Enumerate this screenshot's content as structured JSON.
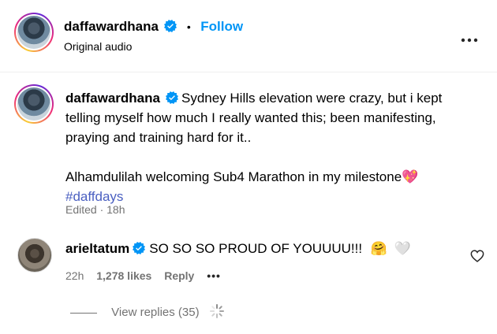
{
  "header": {
    "username": "daffawardhana",
    "separator": "•",
    "follow_label": "Follow",
    "subtitle": "Original audio",
    "more_icon": "more-horizontal-icon"
  },
  "caption": {
    "username": "daffawardhana",
    "text_line1": "Sydney Hills elevation were crazy, but i kept",
    "text_line2": "telling myself how much I really wanted this; been manifesting,",
    "text_line3": "praying and training hard for it..",
    "text_line4": "Alhamdulilah welcoming Sub4 Marathon in my milestone",
    "emoji_heart": "💖",
    "hashtag": "#daffdays",
    "meta": "Edited · 18h"
  },
  "comment": {
    "username": "arieltatum",
    "text": "SO SO SO PROUD OF YOUUUU!!!",
    "emoji_hug": "🤗",
    "emoji_heart": "🤍",
    "time": "22h",
    "likes": "1,278 likes",
    "reply_label": "Reply",
    "more": "•••"
  },
  "replies": {
    "label": "View replies (35)"
  },
  "colors": {
    "accent": "#0095f6",
    "muted": "#737373",
    "hashtag": "#4a5fc1",
    "verified": "#0095f6"
  }
}
